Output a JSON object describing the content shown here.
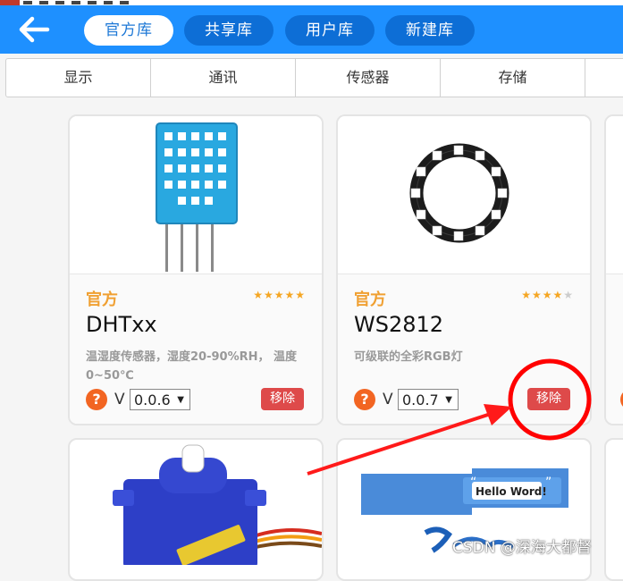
{
  "header": {
    "tabs": [
      {
        "label": "官方库",
        "active": true
      },
      {
        "label": "共享库",
        "active": false
      },
      {
        "label": "用户库",
        "active": false
      },
      {
        "label": "新建库",
        "active": false
      }
    ]
  },
  "categories": [
    "显示",
    "通讯",
    "传感器",
    "存储"
  ],
  "cards": [
    {
      "badge": "官方",
      "rating": 5,
      "name": "DHTxx",
      "description": "温湿度传感器，湿度20-90%RH， 温度0~50℃",
      "version_label": "V",
      "version": "0.0.6",
      "help_symbol": "?",
      "remove_label": "移除"
    },
    {
      "badge": "官方",
      "rating": 3.5,
      "name": "WS2812",
      "description": "可级联的全彩RGB灯",
      "version_label": "V",
      "version": "0.0.7",
      "help_symbol": "?",
      "remove_label": "移除"
    },
    {
      "image_text": "Hello Word!"
    }
  ],
  "watermark": "CSDN @深海大都督",
  "colors": {
    "header": "#1e90ff",
    "official": "#f0a032",
    "remove": "#de4a4a",
    "annotation": "#ff0000"
  },
  "icons": {
    "back": "arrow-left-icon",
    "help": "question-icon",
    "dropdown": "caret-down-icon"
  }
}
